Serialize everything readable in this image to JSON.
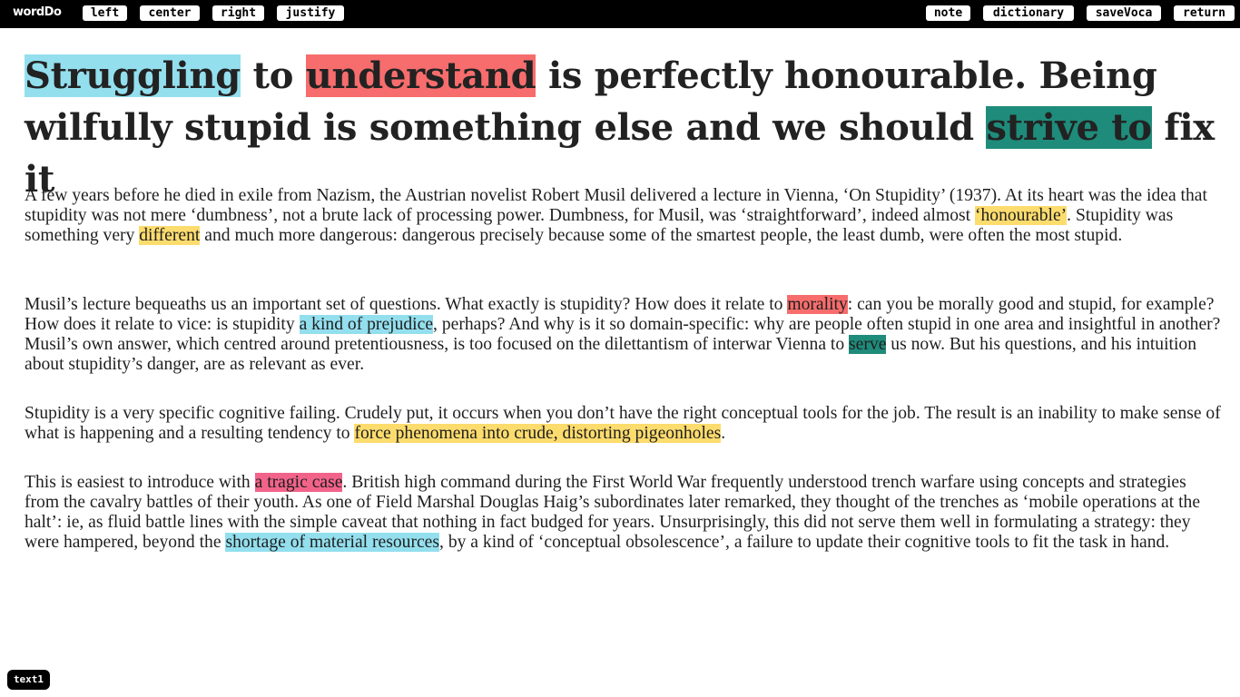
{
  "app": {
    "logo": "wordDo"
  },
  "toolbar": {
    "left": "left",
    "center": "center",
    "right": "right",
    "justify": "justify",
    "note": "note",
    "dictionary": "dictionary",
    "save_voca": "saveVoca",
    "return": "return"
  },
  "colors": {
    "highlight_cyan": "#93dfee",
    "highlight_red": "#f76d6d",
    "highlight_teal": "#1f8b7a",
    "highlight_yellow": "#fddc6e",
    "highlight_pink": "#f2638a",
    "topbar": "#000000"
  },
  "title": {
    "h1": "Struggling",
    "t1": " to ",
    "h2": "understand",
    "t2": " is perfectly honourable. Being wilfully stupid is something else and we should ",
    "h3": "strive to",
    "t3": " fix it"
  },
  "p1": {
    "t1": "A few years before he died in exile from Nazism, the Austrian novelist Robert Musil delivered a lecture in Vienna, ‘On Stupidity’ (1937). At its heart was the idea that stupidity was not mere ‘dumbness’, not a brute lack of processing power. Dumbness, for Musil, was ‘straightforward’, indeed almost ",
    "h1": "‘honourable’",
    "t2": ". Stupidity was something very ",
    "h2": "different",
    "t3": " and much more dangerous: dangerous precisely because some of the smartest people, the least dumb, were often the most stupid."
  },
  "p2": {
    "t1": "Musil’s lecture bequeaths us an important set of questions. What exactly is stupidity? How does it relate to ",
    "h1": "morality",
    "t2": ": can you be morally good and stupid, for example? How does it relate to vice: is stupidity ",
    "h2": "a kind of prejudice",
    "t3": ", perhaps? And why is it so domain-specific: why are people often stupid in one area and insightful in another? Musil’s own answer, which centred around pretentiousness, is too focused on the dilettantism of interwar Vienna to ",
    "h3": "serve",
    "t4": " us now. But his questions, and his intuition about stupidity’s danger, are as relevant as ever."
  },
  "p3": {
    "t1": "Stupidity is a very specific cognitive failing. Crudely put, it occurs when you don’t have the right conceptual tools for the job. The result is an inability to make sense of what is happening and a resulting tendency to ",
    "h1": "force phenomena into crude, distorting pigeonholes",
    "t2": "."
  },
  "p4": {
    "t1": "This is easiest to introduce with ",
    "h1": "a tragic case",
    "t2": ". British high command during the First World War frequently understood trench warfare using concepts and strategies from the cavalry battles of their youth. As one of Field Marshal Douglas Haig’s subordinates later remarked, they thought of the trenches as ‘mobile operations at the halt’: ie, as fluid battle lines with the simple caveat that nothing in fact budged for years. Unsurprisingly, this did not serve them well in formulating a strategy: they were hampered, beyond the ",
    "h2": "shortage of material resources",
    "t3": ", by a kind of ‘conceptual obsolescence’, a failure to update their cognitive tools to fit the task in hand."
  },
  "footer": {
    "tab": "text1"
  }
}
